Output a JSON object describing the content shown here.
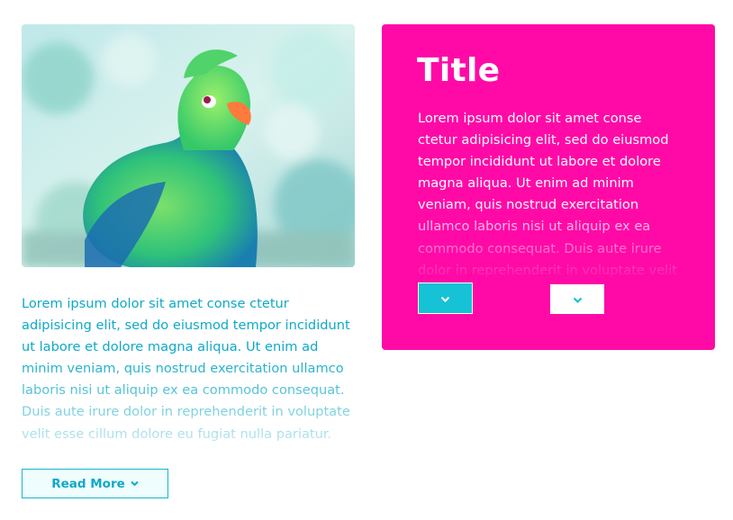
{
  "card": {
    "image_alt": "Green turaco bird",
    "body": "Lorem ipsum dolor sit amet conse ctetur adipisicing elit, sed do eiusmod tempor incididunt ut labore et dolore magna aliqua. Ut enim ad minim veniam, quis nostrud exercitation ullamco laboris nisi ut aliquip ex ea commodo consequat. Duis aute irure dolor in reprehenderit in voluptate velit esse cillum dolore eu fugiat nulla pariatur.",
    "read_more_label": "Read More",
    "read_more_icon": "chevron-down-icon"
  },
  "panel": {
    "title": "Title",
    "body": "Lorem ipsum dolor sit amet conse ctetur adipisicing elit, sed do eiusmod tempor incididunt ut labore et dolore magna aliqua. Ut enim ad minim veniam, quis nostrud exercitation ullamco laboris nisi ut aliquip ex ea commodo consequat. Duis aute irure dolor in reprehenderit in voluptate velit",
    "buttons": [
      {
        "icon": "chevron-down-icon",
        "style": "teal"
      },
      {
        "icon": "chevron-down-icon",
        "style": "white"
      }
    ]
  },
  "colors": {
    "accent_teal": "#16c2d6",
    "text_teal": "#0fa9c8",
    "panel_pink": "#ff0aa7",
    "white": "#ffffff"
  }
}
